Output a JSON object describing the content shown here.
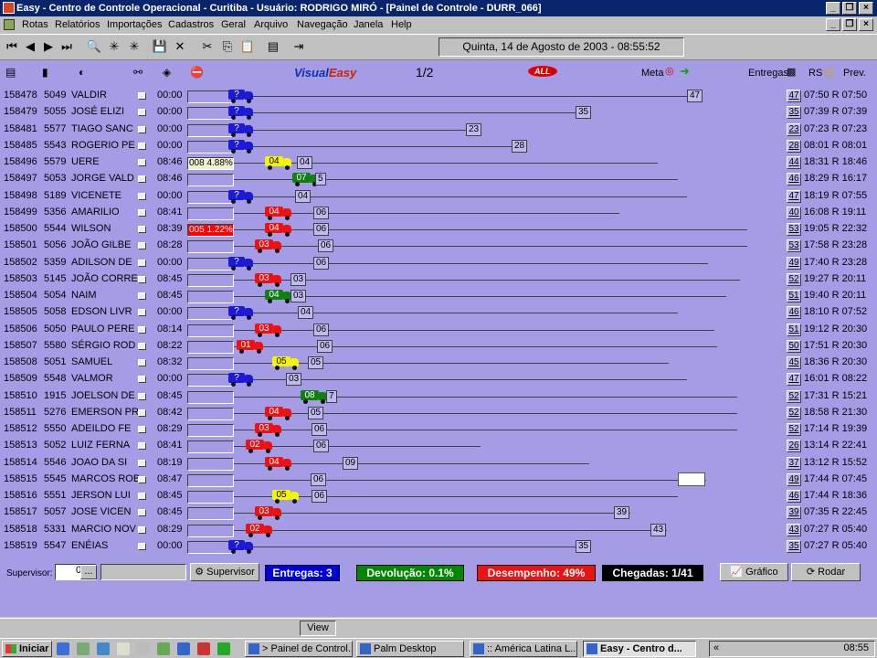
{
  "window": {
    "title": "Easy - Centro de Controle Operacional - Curitiba - Usuário: RODRIGO MIRÓ - [Painel de Controle  -  DURR_066]"
  },
  "menu": [
    "Rotas",
    "Relatórios",
    "Importações",
    "Cadastros",
    "Geral",
    "Arquivo",
    "Navegação",
    "Janela",
    "Help"
  ],
  "toolbar": {
    "datetime": "Quinta, 14 de Agosto de 2003 - 08:55:52"
  },
  "panel": {
    "brand_a": "Visual",
    "brand_b": "Easy",
    "page": "1/2",
    "all_logo": "ALL",
    "meta_label": "Meta",
    "entregas_label": "Entregas",
    "rs_label": "RS",
    "prev_label": "Prev."
  },
  "rows": [
    {
      "id": "158478",
      "code": "5049",
      "name": "VALDIR",
      "time": "00:00",
      "track": "",
      "track_color": "none",
      "truck": "?",
      "truck_color": "blue",
      "end": "47",
      "ret": "47",
      "rtext": "07:50 R 07:50"
    },
    {
      "id": "158479",
      "code": "5055",
      "name": "JOSÉ ELIZI",
      "time": "00:00",
      "track": "",
      "track_color": "none",
      "truck": "?",
      "truck_color": "blue",
      "end": "35",
      "ret": "35",
      "rtext": "07:39 R 07:39"
    },
    {
      "id": "158481",
      "code": "5577",
      "name": "TIAGO SANC",
      "time": "00:00",
      "track": "",
      "track_color": "none",
      "truck": "?",
      "truck_color": "blue",
      "end": "23",
      "ret": "23",
      "rtext": "07:23 R 07:23"
    },
    {
      "id": "158485",
      "code": "5543",
      "name": "ROGERIO PE",
      "time": "00:00",
      "track": "",
      "track_color": "none",
      "truck": "?",
      "truck_color": "blue",
      "end": "28",
      "ret": "28",
      "rtext": "08:01 R 08:01"
    },
    {
      "id": "158496",
      "code": "5579",
      "name": "UERE",
      "time": "08:46",
      "track": "008 4.88%",
      "track_color": "yel",
      "truck": "04",
      "truck_color": "yellow",
      "end": "04",
      "ret": "44",
      "rtext": "18:31 R 18:46"
    },
    {
      "id": "158497",
      "code": "5053",
      "name": "JORGE VALD",
      "time": "08:46",
      "track": "",
      "track_color": "none",
      "truck": "07",
      "truck_color": "green",
      "end": "5",
      "ret": "46",
      "rtext": "18:29 R 16:17"
    },
    {
      "id": "158498",
      "code": "5189",
      "name": "VICENETE",
      "time": "00:00",
      "track": "",
      "track_color": "none",
      "truck": "?",
      "truck_color": "blue",
      "end": "04",
      "ret": "47",
      "rtext": "18:19 R 07:55"
    },
    {
      "id": "158499",
      "code": "5356",
      "name": "AMARILIO",
      "time": "08:41",
      "track": "",
      "track_color": "none",
      "truck": "04",
      "truck_color": "red",
      "end": "06",
      "ret": "40",
      "rtext": "16:08 R 19:11"
    },
    {
      "id": "158500",
      "code": "5544",
      "name": "WILSON",
      "time": "08:39",
      "track": "005 1.22%",
      "track_color": "red",
      "truck": "04",
      "truck_color": "red",
      "end": "06",
      "ret": "53",
      "rtext": "19:05 R 22:32"
    },
    {
      "id": "158501",
      "code": "5056",
      "name": "JOÃO GILBE",
      "time": "08:28",
      "track": "",
      "track_color": "none",
      "truck": "03",
      "truck_color": "red",
      "end": "06",
      "ret": "53",
      "rtext": "17:58 R 23:28"
    },
    {
      "id": "158502",
      "code": "5359",
      "name": "ADILSON DE",
      "time": "00:00",
      "track": "",
      "track_color": "none",
      "truck": "?",
      "truck_color": "blue",
      "end": "06",
      "ret": "49",
      "rtext": "17:40 R 23:28"
    },
    {
      "id": "158503",
      "code": "5145",
      "name": "JOÃO CORRE",
      "time": "08:45",
      "track": "",
      "track_color": "none",
      "truck": "03",
      "truck_color": "red",
      "end": "03",
      "ret": "52",
      "rtext": "19:27 R 20:11"
    },
    {
      "id": "158504",
      "code": "5054",
      "name": "NAIM",
      "time": "08:45",
      "track": "",
      "track_color": "none",
      "truck": "04",
      "truck_color": "green",
      "end": "03",
      "ret": "51",
      "rtext": "19:40 R 20:11"
    },
    {
      "id": "158505",
      "code": "5058",
      "name": "EDSON LIVR",
      "time": "00:00",
      "track": "",
      "track_color": "none",
      "truck": "?",
      "truck_color": "blue",
      "end": "04",
      "ret": "46",
      "rtext": "18:10 R 07:52"
    },
    {
      "id": "158506",
      "code": "5050",
      "name": "PAULO PERE",
      "time": "08:14",
      "track": "",
      "track_color": "none",
      "truck": "03",
      "truck_color": "red",
      "end": "06",
      "ret": "51",
      "rtext": "19:12 R 20:30"
    },
    {
      "id": "158507",
      "code": "5580",
      "name": "SÉRGIO ROD",
      "time": "08:22",
      "track": "",
      "track_color": "none",
      "truck": "01",
      "truck_color": "red",
      "end": "06",
      "ret": "50",
      "rtext": "17:51 R 20:30"
    },
    {
      "id": "158508",
      "code": "5051",
      "name": "SAMUEL",
      "time": "08:32",
      "track": "",
      "track_color": "none",
      "truck": "05",
      "truck_color": "yellow",
      "end": "05",
      "ret": "45",
      "rtext": "18:36 R 20:30"
    },
    {
      "id": "158509",
      "code": "5548",
      "name": "VALMOR",
      "time": "00:00",
      "track": "",
      "track_color": "none",
      "truck": "?",
      "truck_color": "blue",
      "end": "03",
      "ret": "47",
      "rtext": "16:01 R 08:22"
    },
    {
      "id": "158510",
      "code": "1915",
      "name": "JOELSON DE",
      "time": "08:45",
      "track": "",
      "track_color": "none",
      "truck": "08",
      "truck_color": "green",
      "end": "7",
      "ret": "52",
      "rtext": "17:31 R 15:21"
    },
    {
      "id": "158511",
      "code": "5276",
      "name": "EMERSON PR",
      "time": "08:42",
      "track": "",
      "track_color": "none",
      "truck": "04",
      "truck_color": "red",
      "end": "05",
      "ret": "52",
      "rtext": "18:58 R 21:30"
    },
    {
      "id": "158512",
      "code": "5550",
      "name": "ADEILDO FE",
      "time": "08:29",
      "track": "",
      "track_color": "none",
      "truck": "03",
      "truck_color": "red",
      "end": "06",
      "ret": "52",
      "rtext": "17:14 R 19:39"
    },
    {
      "id": "158513",
      "code": "5052",
      "name": "LUIZ FERNA",
      "time": "08:41",
      "track": "",
      "track_color": "none",
      "truck": "02",
      "truck_color": "red",
      "end": "06",
      "ret": "26",
      "rtext": "13:14 R 22:41"
    },
    {
      "id": "158514",
      "code": "5546",
      "name": "JOAO DA SI",
      "time": "08:19",
      "track": "",
      "track_color": "none",
      "truck": "04",
      "truck_color": "red",
      "end": "09",
      "ret": "37",
      "rtext": "13:12 R 15:52"
    },
    {
      "id": "158515",
      "code": "5545",
      "name": "MARCOS ROB",
      "time": "08:47",
      "track": "",
      "track_color": "none",
      "truck": "",
      "truck_color": "none",
      "end": "06",
      "ret": "49",
      "rtext": "17:44 R 07:45"
    },
    {
      "id": "158516",
      "code": "5551",
      "name": "JERSON LUI",
      "time": "08:45",
      "track": "",
      "track_color": "none",
      "truck": "05",
      "truck_color": "yellow",
      "end": "06",
      "ret": "46",
      "rtext": "17:44 R 18:36"
    },
    {
      "id": "158517",
      "code": "5057",
      "name": "JOSE VICEN",
      "time": "08:45",
      "track": "",
      "track_color": "none",
      "truck": "03",
      "truck_color": "red",
      "end": "39",
      "ret": "39",
      "rtext": "07:35 R 22:45"
    },
    {
      "id": "158518",
      "code": "5331",
      "name": "MARCIO NOV",
      "time": "08:29",
      "track": "",
      "track_color": "none",
      "truck": "02",
      "truck_color": "red",
      "end": "43",
      "ret": "43",
      "rtext": "07:27 R 05:40"
    },
    {
      "id": "158519",
      "code": "5547",
      "name": "ENÉIAS",
      "time": "00:00",
      "track": "",
      "track_color": "none",
      "truck": "?",
      "truck_color": "blue",
      "end": "35",
      "ret": "35",
      "rtext": "07:27 R 05:40"
    }
  ],
  "bottom": {
    "supervisor_label": "Supervisor:",
    "supervisor_value": "0",
    "supervisor_btn_dots": "...",
    "supervisor_btn": "Supervisor",
    "entregas": "Entregas: 3",
    "devolucao": "Devolução: 0.1%",
    "desempenho": "Desempenho: 49%",
    "chegadas": "Chegadas: 1/41",
    "grafico": "Gráfico",
    "rodar": "Rodar"
  },
  "statusbar": {
    "view": "View"
  },
  "taskbar": {
    "start": "Iniciar",
    "tasks": [
      "> Painel de Control...",
      "Palm Desktop",
      ":: América Latina L...",
      "Easy - Centro d..."
    ],
    "tray_chevron": "«",
    "clock": "08:55"
  },
  "colors": {
    "panel_bg": "#a59ce6",
    "title_bg": "#08246b",
    "truck_blue": "#1a1ad8",
    "truck_red": "#ee1111",
    "truck_yellow": "#f5f500",
    "truck_green": "#108010"
  }
}
